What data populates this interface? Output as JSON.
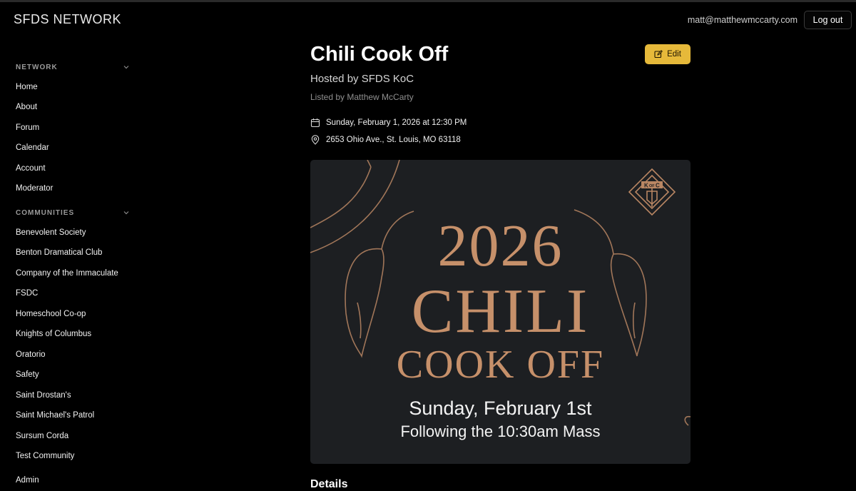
{
  "header": {
    "brand": "SFDS NETWORK",
    "user_email": "matt@matthewmccarty.com",
    "logout_label": "Log out"
  },
  "sidebar": {
    "network_heading": "NETWORK",
    "network_items": [
      "Home",
      "About",
      "Forum",
      "Calendar",
      "Account",
      "Moderator"
    ],
    "communities_heading": "COMMUNITIES",
    "community_items": [
      "Benevolent Society",
      "Benton Dramatical Club",
      "Company of the Immaculate",
      "FSDC",
      "Homeschool Co-op",
      "Knights of Columbus",
      "Oratorio",
      "Safety",
      "Saint Drostan's",
      "Saint Michael's Patrol",
      "Sursum Corda",
      "Test Community"
    ],
    "admin_label": "Admin"
  },
  "event": {
    "title": "Chili Cook Off",
    "hosted_by": "Hosted by SFDS KoC",
    "listed_by": "Listed by Matthew McCarty",
    "edit_label": "Edit",
    "datetime": "Sunday, February 1, 2026 at 12:30 PM",
    "address": "2653 Ohio Ave., St. Louis, MO 63118",
    "details_heading": "Details"
  },
  "poster": {
    "year": "2026",
    "line1": "CHILI",
    "line2": "COOK OFF",
    "date_line": "Sunday, February 1st",
    "follow_line": "Following the 10:30am Mass",
    "emblem_text_top": "K",
    "emblem_text_mid": "OF",
    "emblem_text_right": "C"
  },
  "colors": {
    "accent": "#e6b93a",
    "poster_bg": "#1d1f22",
    "poster_copper": "#c6906a"
  }
}
